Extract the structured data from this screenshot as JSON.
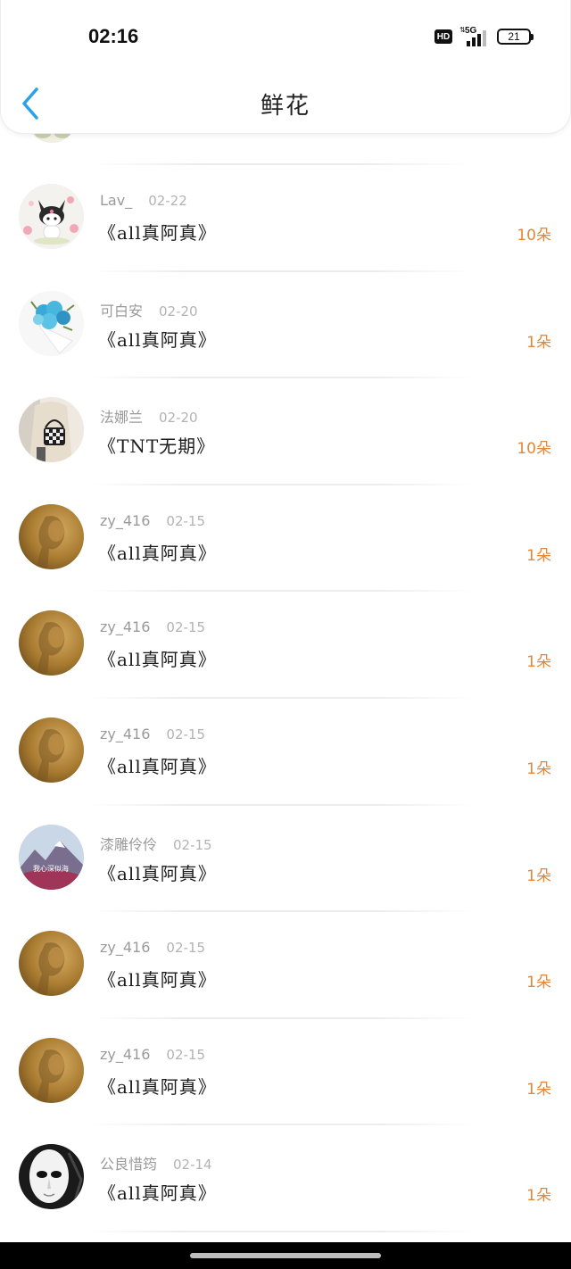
{
  "status_bar": {
    "time": "02:16",
    "hd_label": "HD",
    "network_label": "5G",
    "battery_level": "21"
  },
  "header": {
    "title": "鲜花"
  },
  "colors": {
    "accent_orange": "#e0873a",
    "back_blue": "#2aa1e8",
    "username_gray": "#9a9a9a",
    "date_gray": "#b3b3b3"
  },
  "rows": [
    {
      "user": "Lav_",
      "date": "02-22",
      "title": "《all真阿真》",
      "count": "10朵",
      "avatar": "kuromi-avatar"
    },
    {
      "user": "可白安",
      "date": "02-20",
      "title": "《all真阿真》",
      "count": "1朵",
      "avatar": "bouquet-avatar"
    },
    {
      "user": "法娜兰",
      "date": "02-20",
      "title": "《TNT无期》",
      "count": "10朵",
      "avatar": "girl-bag-avatar"
    },
    {
      "user": "zy_416",
      "date": "02-15",
      "title": "《all真阿真》",
      "count": "1朵",
      "avatar": "golden-portrait-avatar"
    },
    {
      "user": "zy_416",
      "date": "02-15",
      "title": "《all真阿真》",
      "count": "1朵",
      "avatar": "golden-portrait-avatar"
    },
    {
      "user": "zy_416",
      "date": "02-15",
      "title": "《all真阿真》",
      "count": "1朵",
      "avatar": "golden-portrait-avatar"
    },
    {
      "user": "漆雕伶伶",
      "date": "02-15",
      "title": "《all真阿真》",
      "count": "1朵",
      "avatar": "mountain-avatar",
      "avatar_text": "我心深似海"
    },
    {
      "user": "zy_416",
      "date": "02-15",
      "title": "《all真阿真》",
      "count": "1朵",
      "avatar": "golden-portrait-avatar"
    },
    {
      "user": "zy_416",
      "date": "02-15",
      "title": "《all真阿真》",
      "count": "1朵",
      "avatar": "golden-portrait-avatar"
    },
    {
      "user": "公良惜筠",
      "date": "02-14",
      "title": "《all真阿真》",
      "count": "1朵",
      "avatar": "mask-avatar"
    }
  ]
}
